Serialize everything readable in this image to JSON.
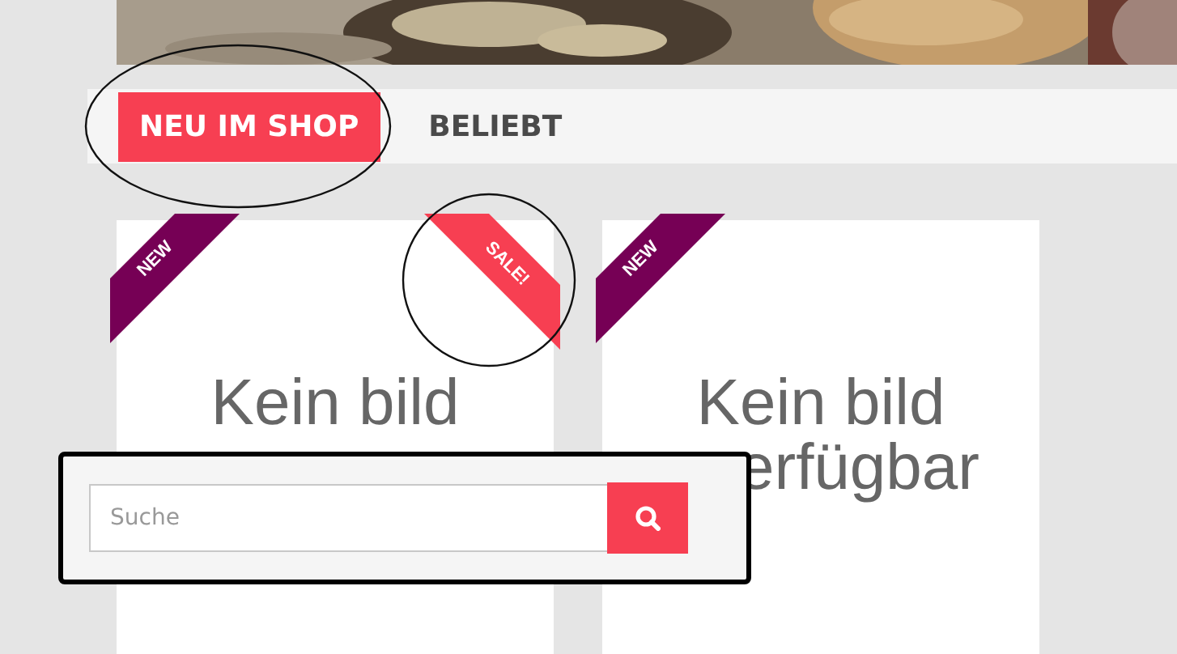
{
  "tabs": [
    {
      "label": "NEU IM SHOP",
      "selected": true
    },
    {
      "label": "BELIEBT",
      "selected": false
    }
  ],
  "products": [
    {
      "image_text": [
        "Kein bild"
      ],
      "ribbons": [
        {
          "kind": "new",
          "label": "NEW"
        },
        {
          "kind": "sale",
          "label": "SALE!"
        }
      ]
    },
    {
      "image_text": [
        "Kein bild",
        "erfügbar"
      ],
      "ribbons": [
        {
          "kind": "new",
          "label": "NEW"
        }
      ]
    }
  ],
  "search": {
    "placeholder": "Suche",
    "button": {
      "kind": "search"
    }
  },
  "annotations": [
    {
      "kind": "ellipse"
    },
    {
      "kind": "circle"
    }
  ]
}
